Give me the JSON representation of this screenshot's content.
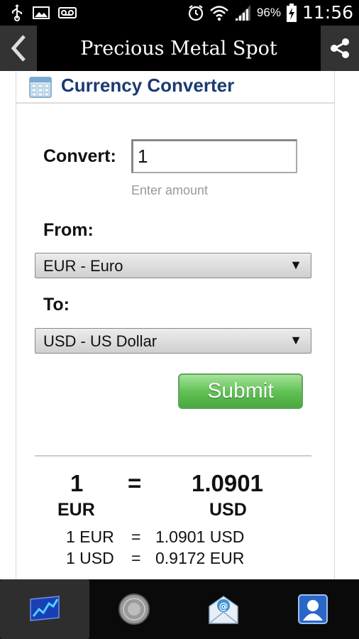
{
  "status_bar": {
    "battery_percent": "96%",
    "time": "11:56"
  },
  "app_bar": {
    "title": "Precious Metal Spot"
  },
  "panel": {
    "title": "Currency Converter"
  },
  "form": {
    "convert_label": "Convert:",
    "amount_value": "1",
    "amount_hint": "Enter amount",
    "from_label": "From:",
    "from_selected": "EUR - Euro",
    "to_label": "To:",
    "to_selected": "USD - US Dollar",
    "submit_label": "Submit"
  },
  "result": {
    "amount": "1",
    "equals": "=",
    "converted": "1.0901",
    "from_code": "EUR",
    "to_code": "USD",
    "rates": [
      {
        "left": "1 EUR",
        "eq": "=",
        "right": "1.0901 USD"
      },
      {
        "left": "1 USD",
        "eq": "=",
        "right": "0.9172 EUR"
      }
    ]
  },
  "bottom_nav": {
    "items": [
      {
        "icon": "chart-icon",
        "active": true
      },
      {
        "icon": "coin-icon",
        "active": false
      },
      {
        "icon": "mail-icon",
        "active": false
      },
      {
        "icon": "contact-icon",
        "active": false
      }
    ]
  }
}
